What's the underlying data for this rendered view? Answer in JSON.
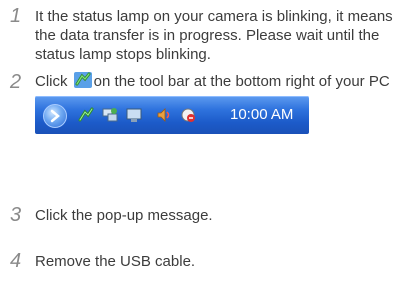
{
  "steps": [
    {
      "number": "1",
      "text": "It the status lamp on your camera is blinking, it means the data transfer is in progress. Please wait until the status lamp stops blinking."
    },
    {
      "number": "2",
      "text_before": "Click",
      "text_after": "on the tool bar at the bottom right of your PC screen."
    },
    {
      "number": "3",
      "text": "Click the pop-up message."
    },
    {
      "number": "4",
      "text": "Remove the USB cable."
    }
  ],
  "taskbar": {
    "time": "10:00 AM",
    "icons": [
      "show-hidden-icons-arrow",
      "safely-remove-hardware-icon",
      "network-connection-icon",
      "display-icon",
      "volume-icon",
      "security-icon"
    ],
    "colors": {
      "bar": "#2f73de",
      "text": "#ffffff"
    }
  },
  "colors": {
    "step_number": "#8a8a8a",
    "body_text": "#3c3c3c"
  }
}
